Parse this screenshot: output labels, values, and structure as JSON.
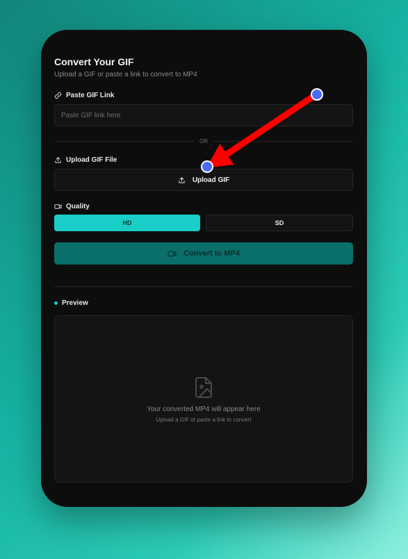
{
  "header": {
    "title": "Convert Your GIF",
    "subtitle": "Upload a GIF or paste a link to convert to MP4"
  },
  "link_section": {
    "label": "Paste GIF Link",
    "icon": "link-icon",
    "placeholder": "Paste GIF link here"
  },
  "divider": {
    "text": "OR"
  },
  "upload_section": {
    "label": "Upload GIF File",
    "icon": "upload-icon",
    "button_label": "Upload GIF"
  },
  "quality": {
    "label": "Quality",
    "icon": "video-icon",
    "options": [
      "HD",
      "SD"
    ],
    "selected": "HD"
  },
  "convert": {
    "label": "Convert to MP4",
    "icon": "video-icon"
  },
  "preview": {
    "label": "Preview",
    "icon": "image-file-icon",
    "empty_title": "Your converted MP4 will appear here",
    "empty_subtitle": "Upload a GIF or paste a link to convert"
  },
  "colors": {
    "accent": "#19cec6",
    "convert_button": "#0a6e69",
    "card_background": "#0d0d0d",
    "annotation_arrow": "#ff0000",
    "annotation_point": "#4a6cf7"
  }
}
